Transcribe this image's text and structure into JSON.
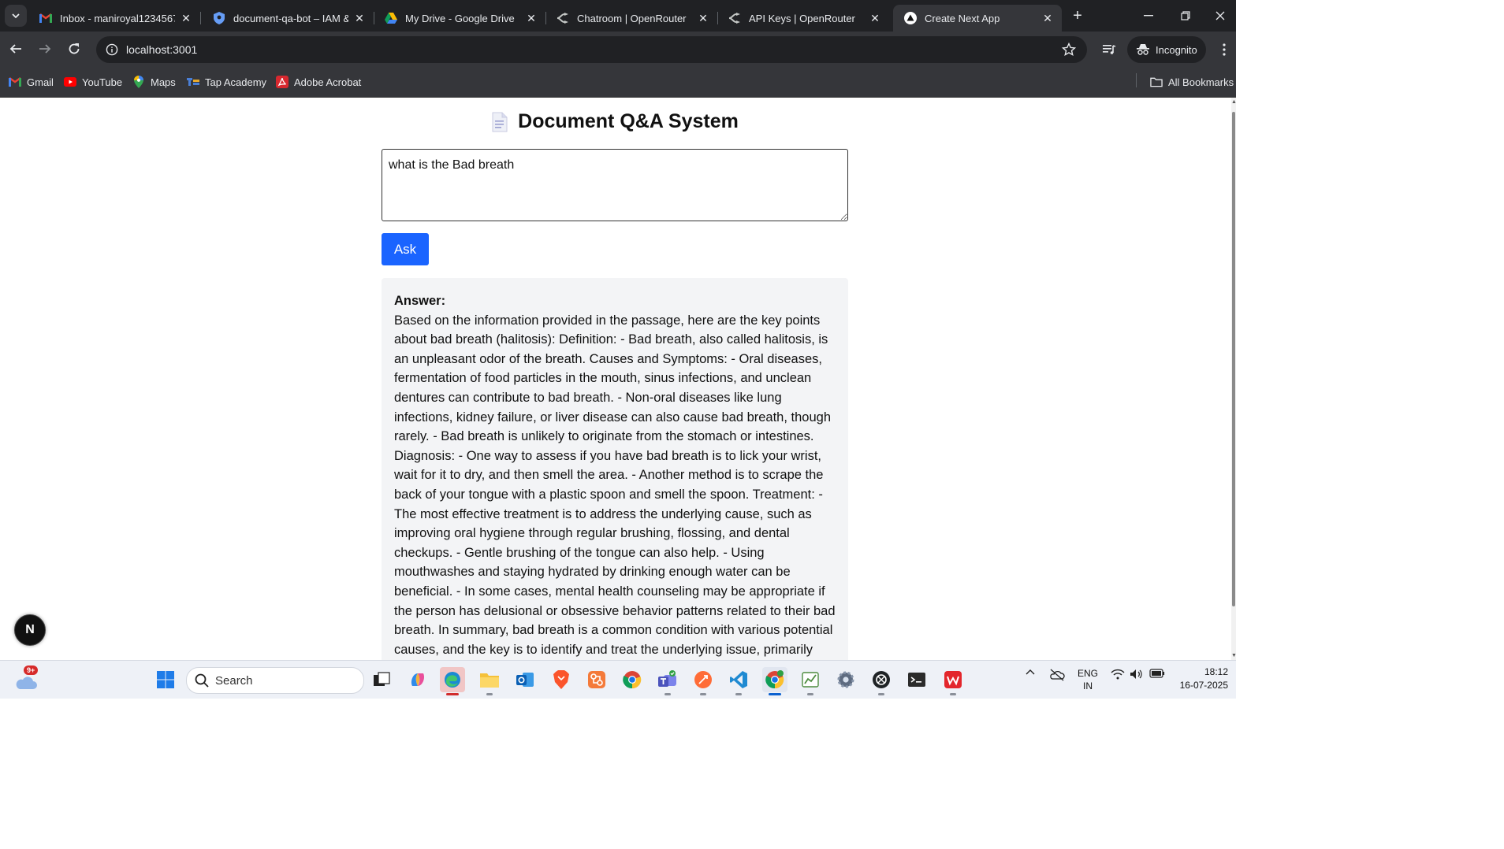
{
  "browser": {
    "tabs": [
      {
        "title": "Inbox - maniroyal1234567@",
        "icon": "gmail-icon"
      },
      {
        "title": "document-qa-bot – IAM &",
        "icon": "shield-icon"
      },
      {
        "title": "My Drive - Google Drive",
        "icon": "google-drive-icon"
      },
      {
        "title": "Chatroom | OpenRouter",
        "icon": "openrouter-icon"
      },
      {
        "title": "API Keys | OpenRouter",
        "icon": "openrouter-icon"
      },
      {
        "title": "Create Next App",
        "icon": "nextjs-icon",
        "active": true
      }
    ],
    "url": "localhost:3001",
    "incognito_label": "Incognito",
    "bookmarks": [
      {
        "label": "Gmail",
        "icon": "gmail-icon"
      },
      {
        "label": "YouTube",
        "icon": "youtube-icon"
      },
      {
        "label": "Maps",
        "icon": "maps-icon"
      },
      {
        "label": "Tap Academy",
        "icon": "tap-academy-icon"
      },
      {
        "label": "Adobe Acrobat",
        "icon": "acrobat-icon"
      }
    ],
    "all_bookmarks_label": "All Bookmarks"
  },
  "page": {
    "title": "Document Q&A System",
    "question_value": "what is the Bad breath",
    "ask_label": "Ask",
    "answer_label": "Answer:",
    "answer_text": "Based on the information provided in the passage, here are the key points about bad breath (halitosis): Definition: - Bad breath, also called halitosis, is an unpleasant odor of the breath. Causes and Symptoms: - Oral diseases, fermentation of food particles in the mouth, sinus infections, and unclean dentures can contribute to bad breath. - Non-oral diseases like lung infections, kidney failure, or liver disease can also cause bad breath, though rarely. - Bad breath is unlikely to originate from the stomach or intestines. Diagnosis: - One way to assess if you have bad breath is to lick your wrist, wait for it to dry, and then smell the area. - Another method is to scrape the back of your tongue with a plastic spoon and smell the spoon. Treatment: - The most effective treatment is to address the underlying cause, such as improving oral hygiene through regular brushing, flossing, and dental checkups. - Gentle brushing of the tongue can also help. - Using mouthwashes and staying hydrated by drinking enough water can be beneficial. - In some cases, mental health counseling may be appropriate if the person has delusional or obsessive behavior patterns related to their bad breath. In summary, bad breath is a common condition with various potential causes, and the key is to identify and treat the underlying issue, primarily",
    "nextjs_badge": "N"
  },
  "taskbar": {
    "search_placeholder": "Search",
    "weather_badge": "9+",
    "language": [
      "ENG",
      "IN"
    ],
    "time": "18:12",
    "date": "16-07-2025"
  },
  "colors": {
    "ask_button": "#1a64ff",
    "answer_bg": "#f3f4f6",
    "chrome_dark": "#202124",
    "chrome_toolbar": "#35363a"
  }
}
